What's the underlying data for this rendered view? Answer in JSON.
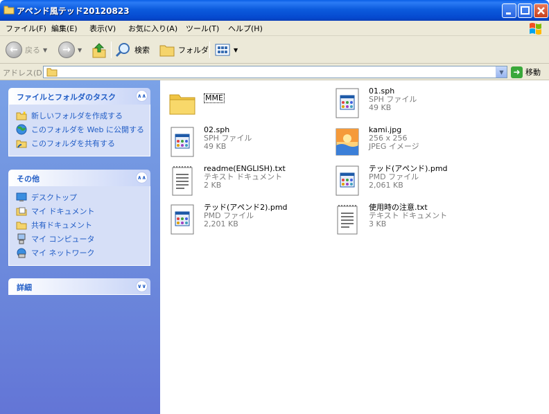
{
  "window": {
    "title": "アペンド風テッド20120823"
  },
  "menu": [
    {
      "label": "ファイル(F)"
    },
    {
      "label": "編集(E)"
    },
    {
      "label": "表示(V)"
    },
    {
      "label": "お気に入り(A)"
    },
    {
      "label": "ツール(T)"
    },
    {
      "label": "ヘルプ(H)"
    }
  ],
  "toolbar": {
    "back": "戻る",
    "search": "検索",
    "folders": "フォルダ"
  },
  "address": {
    "label": "アドレス(D)",
    "value": "",
    "go": "移動"
  },
  "tasks_panel": {
    "title": "ファイルとフォルダのタスク",
    "items": [
      {
        "label": "新しいフォルダを作成する",
        "icon": "new-folder-icon"
      },
      {
        "label": "このフォルダを Web に公開する",
        "icon": "globe-icon"
      },
      {
        "label": "このフォルダを共有する",
        "icon": "share-folder-icon"
      }
    ]
  },
  "other_panel": {
    "title": "その他",
    "items": [
      {
        "label": "デスクトップ",
        "icon": "desktop-icon"
      },
      {
        "label": "マイ ドキュメント",
        "icon": "documents-icon"
      },
      {
        "label": "共有ドキュメント",
        "icon": "shared-folder-icon"
      },
      {
        "label": "マイ コンピュータ",
        "icon": "computer-icon"
      },
      {
        "label": "マイ ネットワーク",
        "icon": "network-icon"
      }
    ]
  },
  "details_panel": {
    "title": "詳細"
  },
  "files": [
    {
      "name": "MME",
      "type": "",
      "size": "",
      "icon": "folder-icon"
    },
    {
      "name": "01.sph",
      "type": "SPH ファイル",
      "size": "49 KB",
      "icon": "generic-file-icon"
    },
    {
      "name": "02.sph",
      "type": "SPH ファイル",
      "size": "49 KB",
      "icon": "generic-file-icon"
    },
    {
      "name": "kami.jpg",
      "type": "256 x 256",
      "size": "JPEG イメージ",
      "icon": "image-file-icon"
    },
    {
      "name": "readme(ENGLISH).txt",
      "type": "テキスト ドキュメント",
      "size": "2 KB",
      "icon": "text-file-icon"
    },
    {
      "name": "テッド(アペンド).pmd",
      "type": "PMD ファイル",
      "size": "2,061 KB",
      "icon": "generic-file-icon"
    },
    {
      "name": "テッド(アペンド2).pmd",
      "type": "PMD ファイル",
      "size": "2,201 KB",
      "icon": "generic-file-icon"
    },
    {
      "name": "使用時の注意.txt",
      "type": "テキスト ドキュメント",
      "size": "3 KB",
      "icon": "text-file-icon"
    }
  ]
}
